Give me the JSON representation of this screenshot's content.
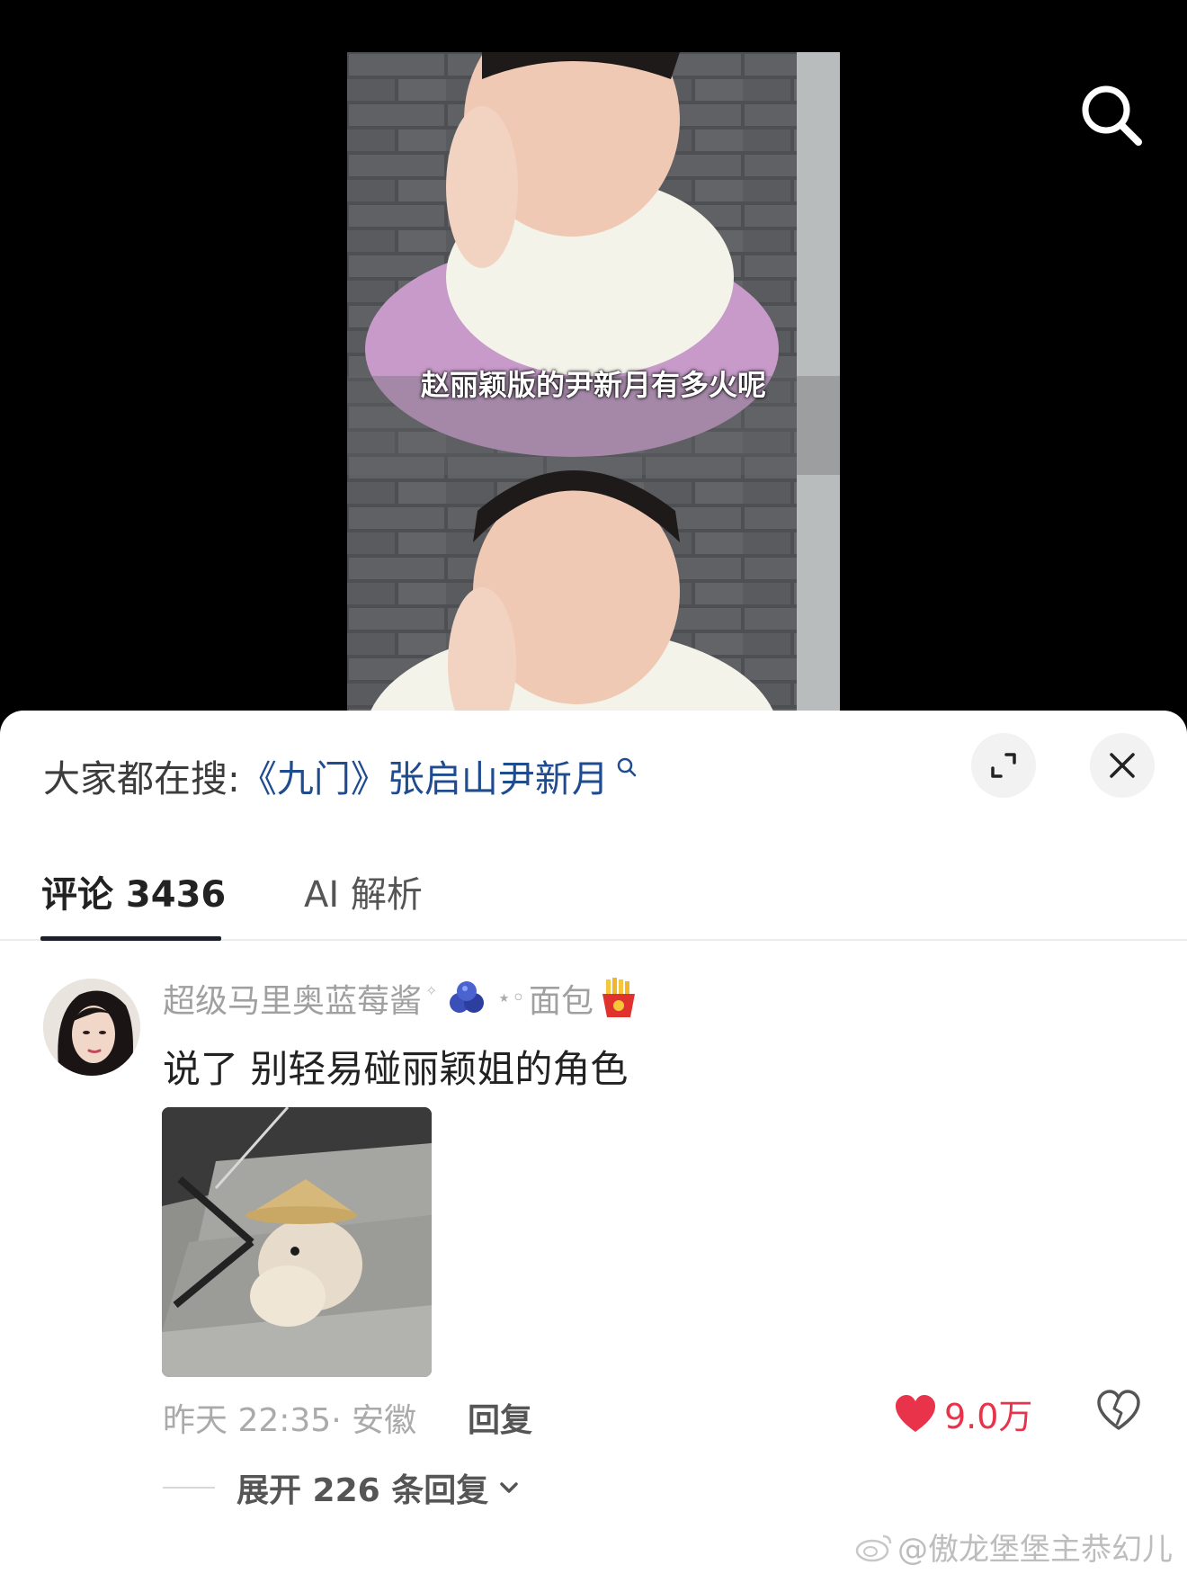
{
  "video": {
    "subtitle": "赵丽颖版的尹新月有多火呢"
  },
  "sheet": {
    "search_hint_prefix": "大家都在搜:",
    "search_hint_query": "《九门》张启山尹新月"
  },
  "tabs": [
    {
      "label": "评论 3436",
      "active": true
    },
    {
      "label": "AI 解析",
      "active": false
    }
  ],
  "comment": {
    "username": "超级马里奥蓝莓酱",
    "username_suffix": "面包",
    "text": "说了 别轻易碰丽颖姐的角色",
    "timestamp": "昨天 22:35",
    "location": "安徽",
    "meta": "昨天 22:35· 安徽",
    "reply_label": "回复",
    "like_count": "9.0万",
    "expand_replies_label": "展开 226 条回复"
  },
  "watermark": "@傲龙堡堡主恭幻儿",
  "colors": {
    "accent_link": "#1f4b8f",
    "like_red": "#e8334a",
    "tab_underline": "#1a1f2e"
  },
  "icons": [
    "search-icon",
    "magnifier-small-icon",
    "expand-icon",
    "close-icon",
    "blueberry-emoji-icon",
    "fries-emoji-icon",
    "heart-icon",
    "broken-heart-icon",
    "chevron-down-icon",
    "weibo-icon"
  ]
}
